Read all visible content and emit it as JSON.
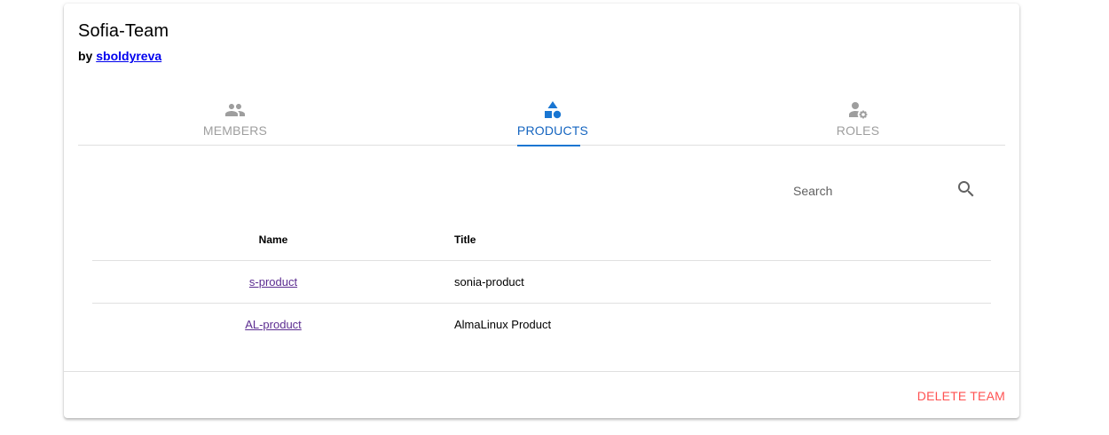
{
  "team": {
    "name": "Sofia-Team",
    "by_prefix": "by",
    "owner": "sboldyreva"
  },
  "tabs": [
    {
      "label": "MEMBERS",
      "icon": "account-group-icon",
      "active": false
    },
    {
      "label": "PRODUCTS",
      "icon": "shapes-icon",
      "active": true
    },
    {
      "label": "ROLES",
      "icon": "account-cog-icon",
      "active": false
    }
  ],
  "search": {
    "placeholder": "Search",
    "icon": "magnify-icon"
  },
  "table": {
    "headers": [
      "Name",
      "Title"
    ],
    "rows": [
      {
        "name": "s-product",
        "title": "sonia-product"
      },
      {
        "name": "AL-product",
        "title": "AlmaLinux Product"
      }
    ]
  },
  "actions": {
    "delete_label": "DELETE TEAM"
  },
  "colors": {
    "accent": "#1976d2",
    "danger": "#ff5252",
    "inactive": "#9e9e9e",
    "link_visited": "#5c2d91"
  }
}
